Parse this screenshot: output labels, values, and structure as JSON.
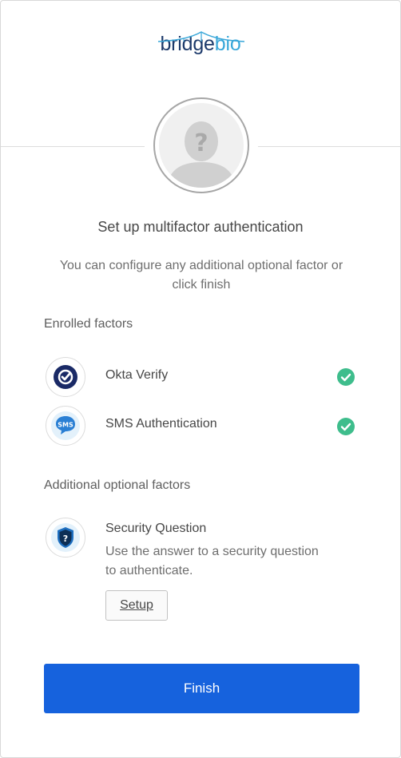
{
  "brand": {
    "part1": "bridge",
    "part2": "bio",
    "color_dark": "#1d3a6b",
    "color_light": "#39a7d9"
  },
  "avatar": {
    "icon": "user-placeholder-icon"
  },
  "title": "Set up multifactor authentication",
  "subtitle": "You can configure any additional optional factor or click finish",
  "enrolled": {
    "label": "Enrolled factors",
    "items": [
      {
        "name": "Okta Verify",
        "icon": "okta-verify-icon",
        "status": "enrolled-check-icon"
      },
      {
        "name": "SMS Authentication",
        "icon": "sms-icon",
        "icon_text": "SMS",
        "status": "enrolled-check-icon"
      }
    ]
  },
  "additional": {
    "label": "Additional optional factors",
    "items": [
      {
        "name": "Security Question",
        "icon": "security-question-icon",
        "description": "Use the answer to a security question to authenticate.",
        "button": "Setup"
      }
    ]
  },
  "finish_button": "Finish",
  "colors": {
    "primary": "#1662dd",
    "success": "#3ebd8c"
  }
}
